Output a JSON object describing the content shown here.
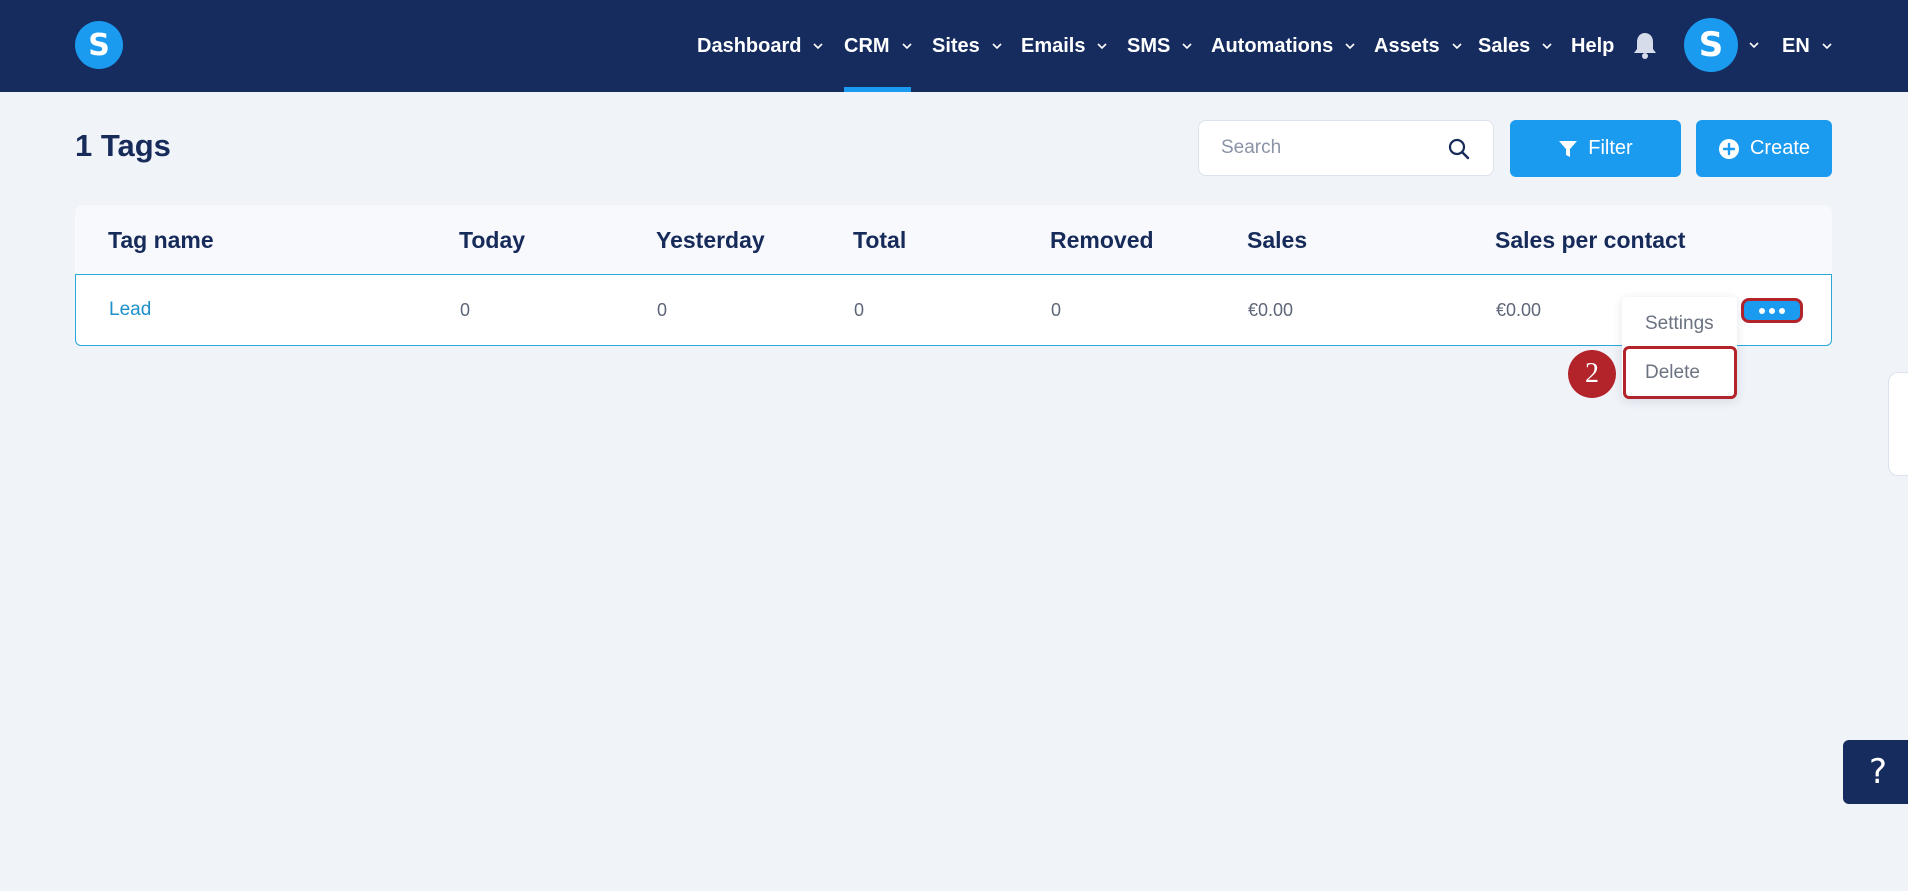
{
  "brand": {
    "logo_letter": "S"
  },
  "nav": {
    "items": [
      {
        "label": "Dashboard",
        "has_dropdown": true
      },
      {
        "label": "CRM",
        "has_dropdown": true,
        "active": true
      },
      {
        "label": "Sites",
        "has_dropdown": true
      },
      {
        "label": "Emails",
        "has_dropdown": true
      },
      {
        "label": "SMS",
        "has_dropdown": true
      },
      {
        "label": "Automations",
        "has_dropdown": true
      },
      {
        "label": "Assets",
        "has_dropdown": true
      },
      {
        "label": "Sales",
        "has_dropdown": true
      },
      {
        "label": "Help",
        "has_dropdown": false
      }
    ],
    "notification_icon": "bell-icon",
    "avatar_letter": "S",
    "language": "EN"
  },
  "page": {
    "title": "1 Tags",
    "search_placeholder": "Search",
    "filter_label": "Filter",
    "create_label": "Create"
  },
  "table": {
    "columns": [
      "Tag name",
      "Today",
      "Yesterday",
      "Total",
      "Removed",
      "Sales",
      "Sales per contact"
    ],
    "rows": [
      {
        "tag_name": "Lead",
        "today": "0",
        "yesterday": "0",
        "total": "0",
        "removed": "0",
        "sales": "€0.00",
        "sales_per_contact": "€0.00"
      }
    ]
  },
  "row_menu": {
    "settings_label": "Settings",
    "delete_label": "Delete"
  },
  "annotation": {
    "step_number": "2"
  },
  "help_button": {
    "label": "?"
  },
  "colors": {
    "topbar": "#162c5e",
    "accent": "#1a9bf0",
    "highlight": "#b2232a",
    "background": "#f0f3f8",
    "link": "#1d8fc9"
  }
}
